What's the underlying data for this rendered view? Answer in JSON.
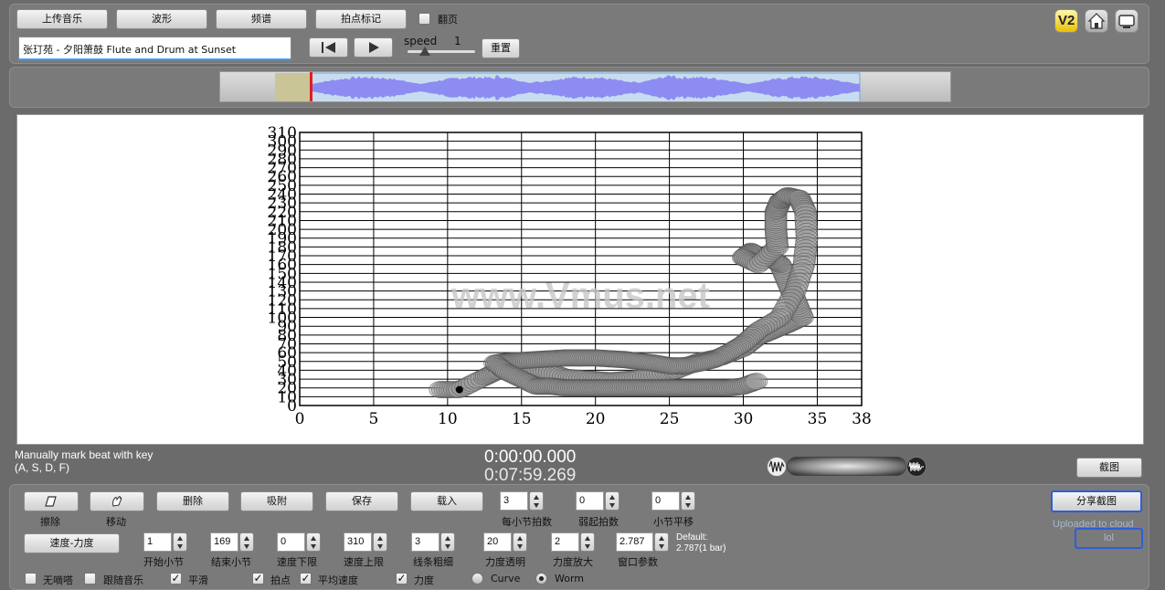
{
  "top": {
    "upload_label": "上传音乐",
    "waveform_label": "波形",
    "spectrum_label": "频谱",
    "beat_mark_label": "拍点标记",
    "flip_label": "翻页",
    "song_title": "张玎苑 - 夕阳箫鼓 Flute and Drum at Sunset",
    "speed_label": "speed",
    "speed_value": "1",
    "speed_level": 0.25,
    "reset_label": "重置",
    "v2_label": "V2"
  },
  "waveform": {
    "wave_color": "#8c8cf2",
    "selection_color": "#c8dcf0",
    "marker_color": "#e02020"
  },
  "chart_data": {
    "type": "scatter",
    "style": "worm",
    "x_ticks": [
      0,
      5,
      10,
      15,
      20,
      25,
      30,
      35,
      38
    ],
    "y_ticks": [
      0,
      10,
      20,
      30,
      40,
      50,
      60,
      70,
      80,
      90,
      100,
      110,
      120,
      130,
      140,
      150,
      160,
      170,
      180,
      190,
      200,
      210,
      220,
      230,
      240,
      250,
      260,
      270,
      280,
      290,
      300,
      310
    ],
    "xlim": [
      0,
      38
    ],
    "ylim": [
      0,
      310
    ],
    "grid": true,
    "watermark": "www.Vmus.net",
    "x": [
      9.5,
      10.8,
      12.5,
      13.5,
      15,
      16.5,
      18,
      19.5,
      21,
      22.5,
      24,
      25.5,
      27,
      28.5,
      30,
      31,
      32,
      33,
      34,
      33.5,
      33,
      32.5,
      31.8,
      31,
      30.5,
      30,
      31,
      32.3,
      32.2,
      32.2,
      32.5,
      33,
      33.8,
      34.2,
      34.3,
      34.1,
      33.5,
      32.5,
      31,
      30,
      29,
      28,
      27,
      26,
      25,
      24,
      23,
      22,
      21,
      20,
      19,
      18,
      17,
      16,
      15,
      14,
      13.2,
      14,
      15,
      16,
      17,
      18,
      19,
      20,
      21,
      22,
      23,
      24,
      25,
      26,
      27,
      28,
      29,
      30,
      31
    ],
    "y": [
      18,
      18,
      32,
      40,
      45,
      40,
      32,
      30,
      28,
      30,
      35,
      40,
      50,
      55,
      65,
      78,
      85,
      92,
      100,
      120,
      140,
      160,
      168,
      170,
      175,
      168,
      160,
      180,
      200,
      220,
      232,
      238,
      235,
      220,
      190,
      160,
      130,
      100,
      85,
      70,
      60,
      52,
      48,
      45,
      45,
      48,
      50,
      52,
      53,
      54,
      54,
      54,
      53,
      52,
      51,
      50,
      48,
      38,
      30,
      22,
      22,
      20,
      20,
      20,
      20,
      20,
      20,
      20,
      20,
      20,
      20,
      20,
      20,
      22,
      28
    ]
  },
  "status": {
    "hint_line1": "Manually mark beat with key",
    "hint_line2": "(A, S, D, F)",
    "time_current": "0:00:00.000",
    "time_total": "0:07:59.269",
    "screenshot_label": "截图"
  },
  "controls": {
    "eraser_label": "擦除",
    "move_label": "移动",
    "delete_label": "删除",
    "snap_label": "吸附",
    "save_label": "保存",
    "load_label": "载入",
    "beats_per_bar_value": "3",
    "beats_per_bar_label": "每小节拍数",
    "pickup_value": "0",
    "pickup_label": "弱起拍数",
    "bar_shift_value": "0",
    "bar_shift_label": "小节平移",
    "share_label": "分享截图",
    "uploaded_text": "Uploaded to cloud",
    "lol_text": "lol",
    "speed_force_label": "速度-力度",
    "start_bar_value": "1",
    "start_bar_label": "开始小节",
    "end_bar_value": "169",
    "end_bar_label": "结束小节",
    "speed_min_value": "0",
    "speed_min_label": "速度下限",
    "speed_max_value": "310",
    "speed_max_label": "速度上限",
    "line_width_value": "3",
    "line_width_label": "线条粗细",
    "force_alpha_value": "20",
    "force_alpha_label": "力度透明",
    "force_scale_value": "2",
    "force_scale_label": "力度放大",
    "window_value": "2.787",
    "window_label": "窗口参数",
    "default_line1": "Default:",
    "default_line2": "2.787(1 bar)",
    "no_click_label": "无嘀嗒",
    "follow_music_label": "跟随音乐",
    "smooth_label": "平滑",
    "beat_point_label": "拍点",
    "avg_speed_label": "平均速度",
    "force_label": "力度",
    "curve_label": "Curve",
    "worm_label": "Worm"
  }
}
